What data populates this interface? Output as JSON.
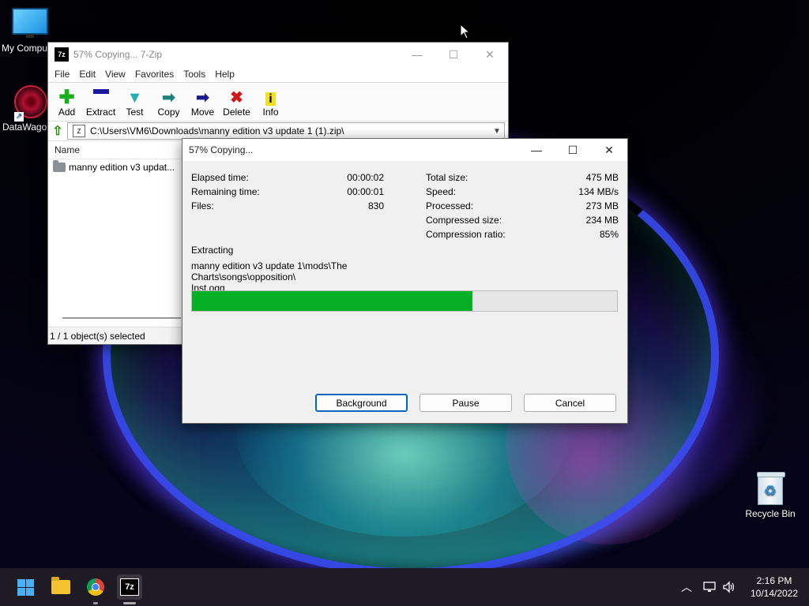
{
  "desktop": {
    "icons": [
      {
        "label": "My Compu"
      },
      {
        "label": "DataWago"
      },
      {
        "label": "Recycle Bin"
      }
    ]
  },
  "main_window": {
    "title": "57% Copying... 7-Zip",
    "menu": [
      "File",
      "Edit",
      "View",
      "Favorites",
      "Tools",
      "Help"
    ],
    "toolbar": [
      {
        "label": "Add",
        "icon": "plus-icon"
      },
      {
        "label": "Extract",
        "icon": "minus-icon"
      },
      {
        "label": "Test",
        "icon": "check-icon"
      },
      {
        "label": "Copy",
        "icon": "copy-arrow-icon"
      },
      {
        "label": "Move",
        "icon": "move-arrow-icon"
      },
      {
        "label": "Delete",
        "icon": "delete-x-icon"
      },
      {
        "label": "Info",
        "icon": "info-icon"
      }
    ],
    "address": "C:\\Users\\VM6\\Downloads\\manny edition v3 update 1 (1).zip\\",
    "list_header": "Name",
    "list_items": [
      "manny edition v3 updat..."
    ],
    "status": "1 / 1 object(s) selected"
  },
  "progress_dialog": {
    "title": "57% Copying...",
    "left_stats": [
      {
        "label": "Elapsed time:",
        "value": "00:00:02"
      },
      {
        "label": "Remaining time:",
        "value": "00:00:01"
      },
      {
        "label": "Files:",
        "value": "830"
      }
    ],
    "right_stats": [
      {
        "label": "Total size:",
        "value": "475 MB"
      },
      {
        "label": "Speed:",
        "value": "134 MB/s"
      },
      {
        "label": "Processed:",
        "value": "273 MB"
      },
      {
        "label": "Compressed size:",
        "value": "234 MB"
      },
      {
        "label": "Compression ratio:",
        "value": "85%"
      }
    ],
    "operation": "Extracting",
    "current_path_line1": "manny edition v3 update 1\\mods\\The Charts\\songs\\opposition\\",
    "current_path_line2": "Inst.ogg",
    "progress_fraction": 0.66,
    "progress_color": "#06b025",
    "buttons": {
      "background": "Background",
      "pause": "Pause",
      "cancel": "Cancel"
    }
  },
  "taskbar": {
    "items": [
      "start-button",
      "file-explorer",
      "chrome",
      "7-zip"
    ],
    "time": "2:16 PM",
    "date": "10/14/2022"
  }
}
